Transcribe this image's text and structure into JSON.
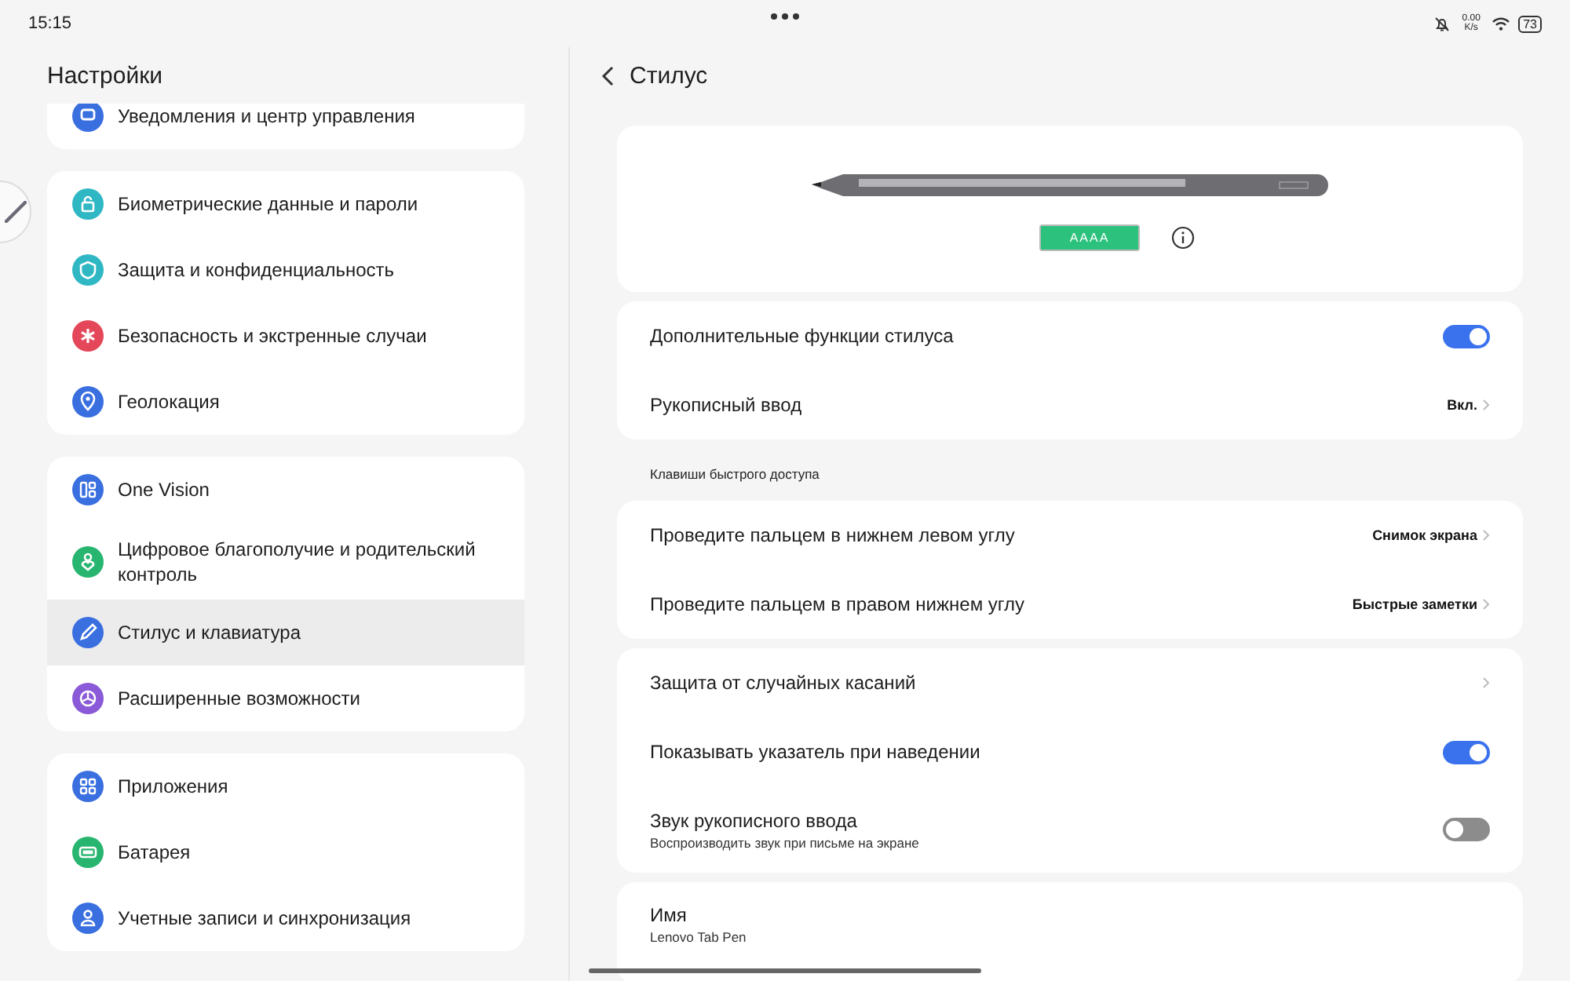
{
  "status_bar": {
    "time": "15:15",
    "net_speed": "0.00 K/s",
    "battery": "73"
  },
  "sidebar": {
    "title": "Настройки",
    "groups": [
      {
        "items": [
          {
            "label": "Уведомления и центр управления",
            "color": "#3a6fe0",
            "selected": false
          }
        ]
      },
      {
        "items": [
          {
            "label": "Биометрические данные и пароли",
            "color": "#2fb8c4",
            "selected": false
          },
          {
            "label": "Защита и конфиденциальность",
            "color": "#2fb8c4",
            "selected": false
          },
          {
            "label": "Безопасность и экстренные случаи",
            "color": "#e5475a",
            "selected": false
          },
          {
            "label": "Геолокация",
            "color": "#3a6fe0",
            "selected": false
          }
        ]
      },
      {
        "items": [
          {
            "label": "One Vision",
            "color": "#3a6fe0",
            "selected": false
          },
          {
            "label": "Цифровое благополучие и родительский контроль",
            "color": "#27b56f",
            "selected": false
          },
          {
            "label": "Стилус и клавиатура",
            "color": "#3a6fe0",
            "selected": true
          },
          {
            "label": "Расширенные возможности",
            "color": "#8a5ad8",
            "selected": false
          }
        ]
      },
      {
        "items": [
          {
            "label": "Приложения",
            "color": "#3a6fe0",
            "selected": false
          },
          {
            "label": "Батарея",
            "color": "#27b56f",
            "selected": false
          },
          {
            "label": "Учетные записи и синхронизация",
            "color": "#3a6fe0",
            "selected": false
          }
        ]
      }
    ]
  },
  "page": {
    "title": "Стилус",
    "battery": {
      "label": "AAAA",
      "level": 1
    },
    "sections": [
      {
        "rows": [
          {
            "kind": "toggle",
            "label": "Дополнительные функции стилуса",
            "on": true
          },
          {
            "kind": "link",
            "label": "Рукописный ввод",
            "value": "Вкл."
          }
        ]
      },
      {
        "heading": "Клавиши быстрого доступа",
        "rows": [
          {
            "kind": "link",
            "label": "Проведите пальцем в нижнем левом углу",
            "value": "Снимок экрана"
          },
          {
            "kind": "link",
            "label": "Проведите пальцем в правом нижнем углу",
            "value": "Быстрые заметки"
          }
        ]
      },
      {
        "rows": [
          {
            "kind": "link",
            "label": "Защита от случайных касаний"
          },
          {
            "kind": "toggle",
            "label": "Показывать указатель при наведении",
            "on": true
          },
          {
            "kind": "toggle",
            "label": "Звук рукописного ввода",
            "subtitle": "Воспроизводить звук при письме на экране",
            "on": false
          }
        ]
      },
      {
        "rows": [
          {
            "kind": "info",
            "label": "Имя",
            "subtitle": "Lenovo Tab Pen"
          }
        ]
      }
    ]
  }
}
